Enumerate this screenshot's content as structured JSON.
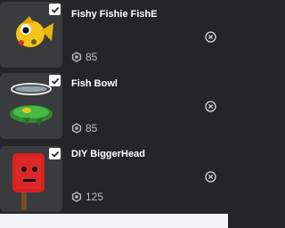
{
  "items": [
    {
      "name": "Fishy Fishie FishE",
      "price": "85",
      "checked": true,
      "icon": "robux-icon"
    },
    {
      "name": "Fish Bowl",
      "price": "85",
      "checked": true,
      "icon": "robux-icon"
    },
    {
      "name": "DIY BiggerHead",
      "price": "125",
      "checked": true,
      "icon": "robux-icon"
    }
  ],
  "colors": {
    "background": "#232527",
    "thumb": "#393b3d",
    "text": "#ffffff",
    "price": "#bdbebe"
  }
}
